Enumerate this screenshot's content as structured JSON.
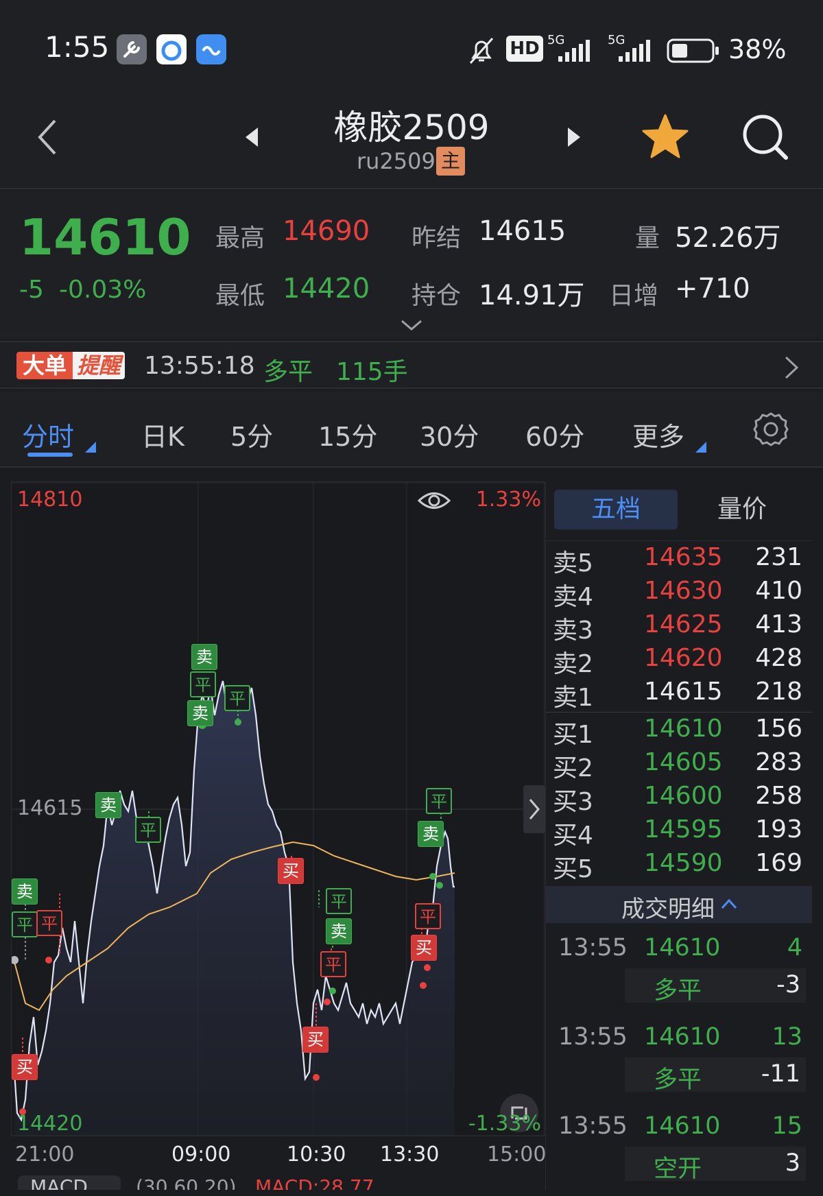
{
  "status_bar": {
    "time": "1:55",
    "battery": "38%",
    "network1": "5G",
    "network2": "5G",
    "hd": "HD"
  },
  "header": {
    "title": "橡胶2509",
    "code": "ru2509",
    "main_badge": "主",
    "back_icon": "chevron-left-icon",
    "prev_icon": "triangle-left-icon",
    "next_icon": "triangle-right-icon",
    "favorite_color": "#f0a83a"
  },
  "quote": {
    "last_price": "14610",
    "change": "-5",
    "change_pct": "-0.03%",
    "high_label": "最高",
    "high": "14690",
    "low_label": "最低",
    "low": "14420",
    "prev_settle_label": "昨结",
    "prev_settle": "14615",
    "open_interest_label": "持仓",
    "open_interest": "14.91万",
    "volume_label": "量",
    "volume": "52.26万",
    "daily_inc_label": "日增",
    "daily_inc": "+710"
  },
  "alert": {
    "badge1": "大单",
    "badge2": "提醒",
    "time": "13:55:18",
    "action": "多平",
    "qty": "115手"
  },
  "tabs": [
    {
      "label": "分时"
    },
    {
      "label": "日K"
    },
    {
      "label": "5分"
    },
    {
      "label": "15分"
    },
    {
      "label": "30分"
    },
    {
      "label": "60分"
    },
    {
      "label": "更多"
    }
  ],
  "chart": {
    "top_price": "14810",
    "bottom_price": "14420",
    "mid_price": "14615",
    "top_pct": "1.33%",
    "bottom_pct": "-1.33%",
    "time_labels": [
      "21:00",
      "09:00",
      "10:30",
      "13:30",
      "15:00"
    ],
    "indicator": "MACD",
    "indicator_params": "(30,60,20)",
    "indicator_value": "MACD:28.77",
    "markers": [
      "卖",
      "平",
      "卖",
      "平",
      "卖",
      "平",
      "卖",
      "平",
      "平",
      "卖",
      "买",
      "买",
      "平",
      "卖",
      "平",
      "平",
      "卖",
      "平",
      "买",
      "买",
      "平"
    ]
  },
  "order_book": {
    "tab_active": "五档",
    "tab_other": "量价",
    "asks": [
      {
        "label": "卖5",
        "price": "14635",
        "vol": "231"
      },
      {
        "label": "卖4",
        "price": "14630",
        "vol": "410"
      },
      {
        "label": "卖3",
        "price": "14625",
        "vol": "413"
      },
      {
        "label": "卖2",
        "price": "14620",
        "vol": "428"
      },
      {
        "label": "卖1",
        "price": "14615",
        "vol": "218"
      }
    ],
    "bids": [
      {
        "label": "买1",
        "price": "14610",
        "vol": "156"
      },
      {
        "label": "买2",
        "price": "14605",
        "vol": "283"
      },
      {
        "label": "买3",
        "price": "14600",
        "vol": "258"
      },
      {
        "label": "买4",
        "price": "14595",
        "vol": "193"
      },
      {
        "label": "买5",
        "price": "14590",
        "vol": "169"
      }
    ],
    "trades_header": "成交明细",
    "trades": [
      {
        "time": "13:55",
        "price": "14610",
        "qty": "4",
        "type": "多平",
        "delta": "-3"
      },
      {
        "time": "13:55",
        "price": "14610",
        "qty": "13",
        "type": "多平",
        "delta": "-11"
      },
      {
        "time": "13:55",
        "price": "14610",
        "qty": "15",
        "type": "空开",
        "delta": "3"
      }
    ]
  }
}
